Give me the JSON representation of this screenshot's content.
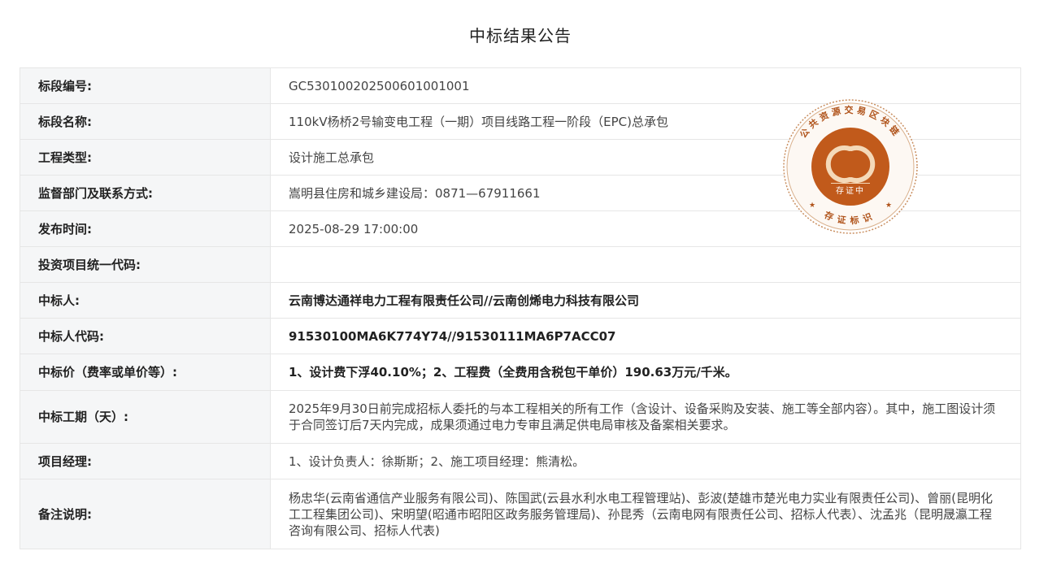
{
  "page": {
    "title": "中标结果公告"
  },
  "rows": [
    {
      "label": "标段编号:",
      "value": "GC5301002025006010010​01"
    },
    {
      "label": "标段名称:",
      "value": "110kV杨桥2号输变电工程（一期）项目线路工程一阶段（EPC)总承包"
    },
    {
      "label": "工程类型:",
      "value": "设计施工总承包"
    },
    {
      "label": "监督部门及联系方式:",
      "value": "嵩明县住房和城乡建设局：0871—67911661"
    },
    {
      "label": "发布时间:",
      "value": "2025-08-29 17:00:00"
    },
    {
      "label": "投资项目统一代码:",
      "value": ""
    },
    {
      "label": "中标人:",
      "value": "云南博达通祥电力工程有限责任公司//云南创烯电力科技有限公司"
    },
    {
      "label": "中标人代码:",
      "value": "91530100MA6K774Y74//91530111MA6P7ACC07"
    },
    {
      "label": "中标价（费率或单价等）:",
      "value": "1、设计费下浮40.10%；2、工程费（全费用含税包干单价）190.63万元/千米。"
    },
    {
      "label": "中标工期（天）:",
      "value": "2025年9月30日前完成招标人委托的与本工程相关的所有工作（含设计、设备采购及安装、施工等全部内容）。其中，施工图设计须于合同签订后7天内完成，成果须通过电力专审且满足供电局审核及备案相关要求。"
    },
    {
      "label": "项目经理:",
      "value": "1、设计负责人：徐斯斯；2、施工项目经理：熊清松。"
    },
    {
      "label": "备注说明:",
      "value": "杨忠华(云南省通信产业服务有限公司)、陈国武(云县水利水电工程管理站)、彭波(楚雄市楚光电力实业有限责任公司)、曾丽(昆明化工工程集团公司)、宋明望(昭通市昭阳区政务服务管理局)、孙昆秀（云南电网有限责任公司、招标人代表）、沈孟兆（昆明晟瀛工程咨询有限公司、招标人代表)"
    }
  ],
  "seal": {
    "top_text": "公共资源交易区块链",
    "bottom_text": "存证标识",
    "center_text": "存证中",
    "color": "#c15a1b"
  }
}
